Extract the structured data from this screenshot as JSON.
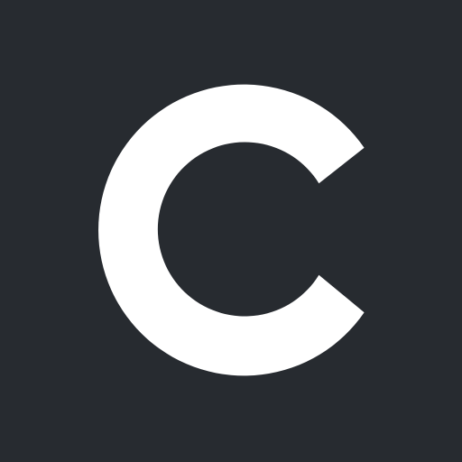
{
  "icon": {
    "name": "c-logo-icon",
    "background_color": "#272b30",
    "logo_color": "#ffffff"
  }
}
